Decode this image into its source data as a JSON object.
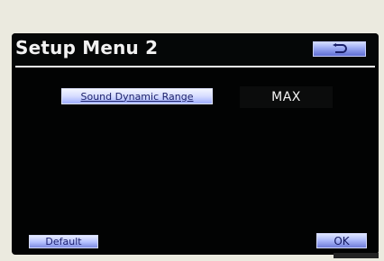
{
  "screen": {
    "title": "Setup Menu 2"
  },
  "buttons": {
    "back_icon": "u-turn-back-arrow-icon",
    "sound_dynamic_range_label": "Sound Dynamic Range",
    "default_label": "Default",
    "ok_label": "OK"
  },
  "setting": {
    "value": "MAX"
  },
  "colors": {
    "screen_bg": "#020303",
    "button_blue": "#9aa8f2",
    "button_text": "#1a1f69",
    "bezel": "#ebeadf"
  }
}
